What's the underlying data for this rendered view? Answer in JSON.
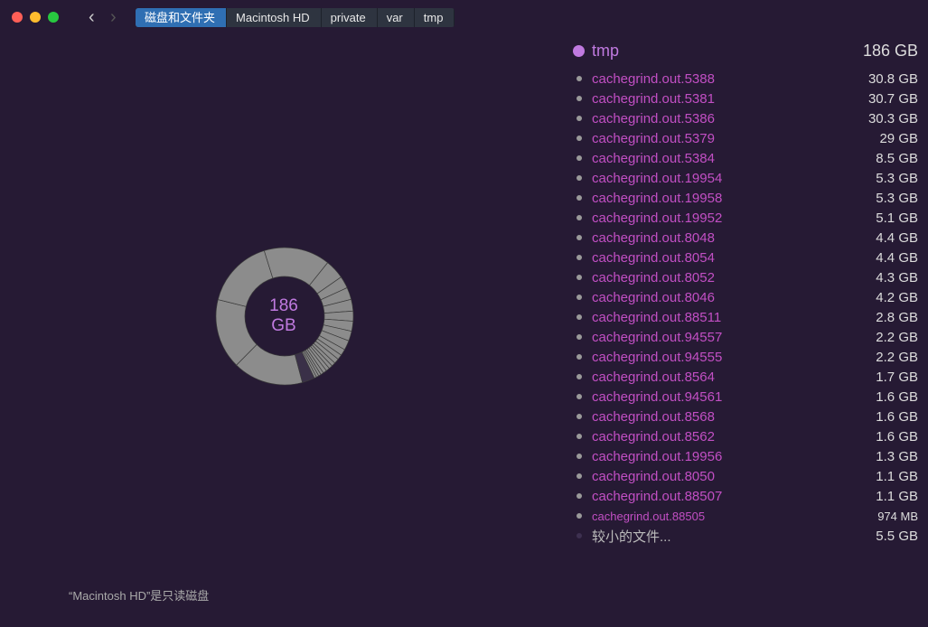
{
  "window": {
    "traffic_colors": [
      "#ff5f57",
      "#febc2e",
      "#28c840"
    ]
  },
  "breadcrumb": [
    "磁盘和文件夹",
    "Macintosh HD",
    "private",
    "var",
    "tmp"
  ],
  "root": {
    "name": "tmp",
    "size": "186 GB",
    "center_value": "186",
    "center_unit": "GB",
    "total_gb": 186
  },
  "items": [
    {
      "name": "cachegrind.out.5388",
      "size": "30.8 GB",
      "gb": 30.8
    },
    {
      "name": "cachegrind.out.5381",
      "size": "30.7 GB",
      "gb": 30.7
    },
    {
      "name": "cachegrind.out.5386",
      "size": "30.3 GB",
      "gb": 30.3
    },
    {
      "name": "cachegrind.out.5379",
      "size": "29    GB",
      "gb": 29
    },
    {
      "name": "cachegrind.out.5384",
      "size": "8.5 GB",
      "gb": 8.5
    },
    {
      "name": "cachegrind.out.19954",
      "size": "5.3 GB",
      "gb": 5.3
    },
    {
      "name": "cachegrind.out.19958",
      "size": "5.3 GB",
      "gb": 5.3
    },
    {
      "name": "cachegrind.out.19952",
      "size": "5.1 GB",
      "gb": 5.1
    },
    {
      "name": "cachegrind.out.8048",
      "size": "4.4 GB",
      "gb": 4.4
    },
    {
      "name": "cachegrind.out.8054",
      "size": "4.4 GB",
      "gb": 4.4
    },
    {
      "name": "cachegrind.out.8052",
      "size": "4.3 GB",
      "gb": 4.3
    },
    {
      "name": "cachegrind.out.8046",
      "size": "4.2 GB",
      "gb": 4.2
    },
    {
      "name": "cachegrind.out.88511",
      "size": "2.8 GB",
      "gb": 2.8
    },
    {
      "name": "cachegrind.out.94557",
      "size": "2.2 GB",
      "gb": 2.2
    },
    {
      "name": "cachegrind.out.94555",
      "size": "2.2 GB",
      "gb": 2.2
    },
    {
      "name": "cachegrind.out.8564",
      "size": "1.7 GB",
      "gb": 1.7
    },
    {
      "name": "cachegrind.out.94561",
      "size": "1.6 GB",
      "gb": 1.6
    },
    {
      "name": "cachegrind.out.8568",
      "size": "1.6 GB",
      "gb": 1.6
    },
    {
      "name": "cachegrind.out.8562",
      "size": "1.6 GB",
      "gb": 1.6
    },
    {
      "name": "cachegrind.out.19956",
      "size": "1.3 GB",
      "gb": 1.3
    },
    {
      "name": "cachegrind.out.8050",
      "size": "1.1 GB",
      "gb": 1.1
    },
    {
      "name": "cachegrind.out.88507",
      "size": "1.1 GB",
      "gb": 1.1
    },
    {
      "name": "cachegrind.out.88505",
      "size": "974    MB",
      "gb": 0.974,
      "small": true
    }
  ],
  "other": {
    "name": "较小的文件...",
    "size": "5.5 GB",
    "gb": 5.5
  },
  "footer": "“Macintosh HD”是只读磁盘",
  "colors": {
    "segment": "#8c8c8c",
    "other_segment": "#3a3048",
    "accent": "#c07ae0"
  }
}
